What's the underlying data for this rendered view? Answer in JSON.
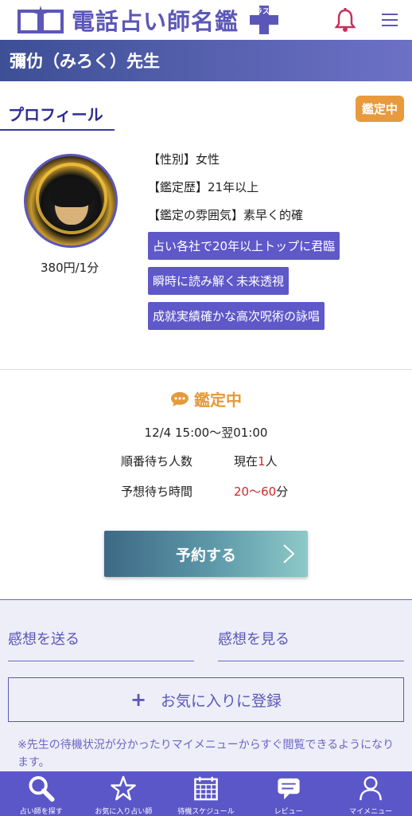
{
  "header": {
    "logo_text": "電話占い師名鑑",
    "logo_badge": "プラス",
    "bell_icon": "bell-icon",
    "menu_icon": "hamburger-icon"
  },
  "title": {
    "teacher_name": "彌仂（みろく）先生"
  },
  "profile": {
    "tab_label": "プロフィール",
    "status_badge": "鑑定中",
    "price": "380円/1分",
    "gender": "【性別】女性",
    "history": "【鑑定歴】21年以上",
    "atmosphere": "【鑑定の雰囲気】素早く的確",
    "tags": [
      "占い各社で20年以上トップに君臨",
      "瞬時に読み解く未来透視",
      "成就実績確かな高次呪術の詠唱"
    ]
  },
  "status": {
    "title": "鑑定中",
    "schedule": "12/4 15:00〜翌01:00",
    "queue_label": "順番待ち人数",
    "queue_prefix": "現在",
    "queue_count": "1",
    "queue_suffix": "人",
    "wait_label": "予想待ち時間",
    "wait_value": "20〜60",
    "wait_suffix": "分",
    "reserve_label": "予約する"
  },
  "review": {
    "send_label": "感想を送る",
    "view_label": "感想を見る",
    "fav_label": "お気に入りに登録",
    "note": "※先生の待機状況が分かったりマイメニューからすぐ閲覧できるようになります。"
  },
  "nav": {
    "items": [
      {
        "label": "占い師を探す",
        "icon": "search-icon"
      },
      {
        "label": "お気に入り占い師",
        "icon": "star-icon"
      },
      {
        "label": "待機スケジュール",
        "icon": "calendar-icon"
      },
      {
        "label": "レビュー",
        "icon": "chat-icon"
      },
      {
        "label": "マイメニュー",
        "icon": "user-icon"
      }
    ]
  },
  "colors": {
    "brand": "#5b57c9",
    "accent": "#e89a3d",
    "wait_red": "#cc2a2a"
  }
}
